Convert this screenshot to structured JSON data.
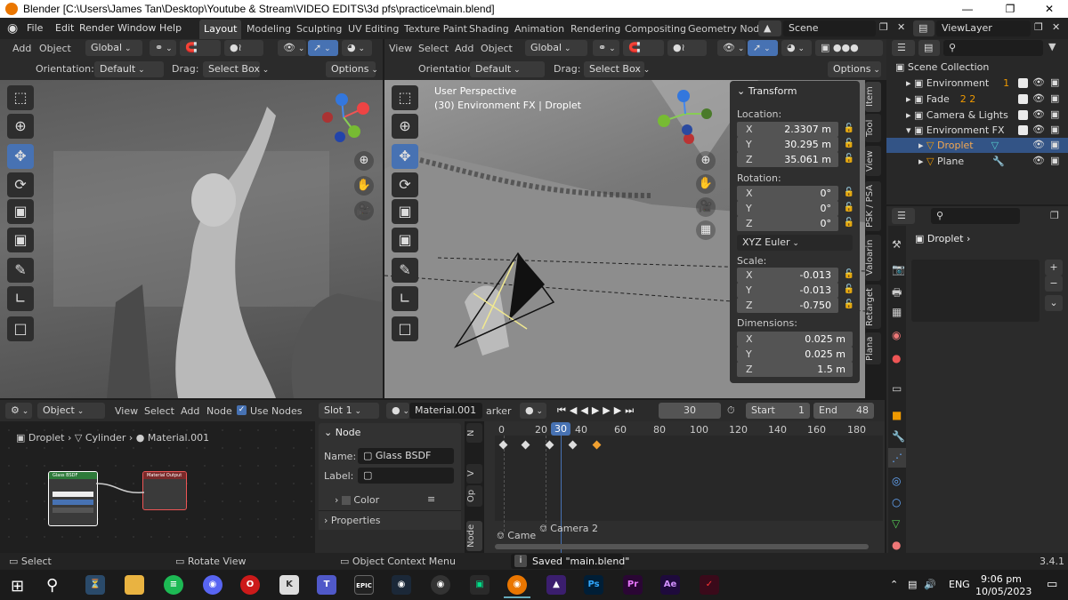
{
  "window": {
    "title": "Blender [C:\\Users\\James Tan\\Desktop\\Youtube & Stream\\VIDEO EDITS\\3d pfs\\practice\\main.blend]"
  },
  "menu": [
    "File",
    "Edit",
    "Render",
    "Window",
    "Help"
  ],
  "workspaces": [
    "Layout",
    "Modeling",
    "Sculpting",
    "UV Editing",
    "Texture Paint",
    "Shading",
    "Animation",
    "Rendering",
    "Compositing",
    "Geometry Node"
  ],
  "scene": "Scene",
  "view_layer": "ViewLayer",
  "left_vp": {
    "menu": [
      "Add",
      "Object"
    ],
    "transform": "Global",
    "orientation_label": "Orientation:",
    "orientation": "Default",
    "drag_label": "Drag:",
    "drag": "Select Box",
    "options": "Options"
  },
  "right_vp": {
    "menu": [
      "View",
      "Select",
      "Add",
      "Object"
    ],
    "transform": "Global",
    "orientation_label": "Orientation:",
    "orientation": "Default",
    "drag_label": "Drag:",
    "drag": "Select Box",
    "options": "Options",
    "info_line1": "User Perspective",
    "info_line2": "(30) Environment FX | Droplet"
  },
  "npanel": {
    "title": "Transform",
    "location_label": "Location:",
    "location": [
      {
        "axis": "X",
        "value": "2.3307 m"
      },
      {
        "axis": "Y",
        "value": "30.295 m"
      },
      {
        "axis": "Z",
        "value": "35.061 m"
      }
    ],
    "rotation_label": "Rotation:",
    "rotation": [
      {
        "axis": "X",
        "value": "0°"
      },
      {
        "axis": "Y",
        "value": "0°"
      },
      {
        "axis": "Z",
        "value": "0°"
      }
    ],
    "rotation_mode": "XYZ Euler",
    "scale_label": "Scale:",
    "scale": [
      {
        "axis": "X",
        "value": "-0.013"
      },
      {
        "axis": "Y",
        "value": "-0.013"
      },
      {
        "axis": "Z",
        "value": "-0.750"
      }
    ],
    "dimensions_label": "Dimensions:",
    "dimensions": [
      {
        "axis": "X",
        "value": "0.025 m"
      },
      {
        "axis": "Y",
        "value": "0.025 m"
      },
      {
        "axis": "Z",
        "value": "1.5 m"
      }
    ],
    "tabs": [
      "Item",
      "Tool",
      "View",
      "PSK / PSA",
      "Valoarin",
      "Retarget",
      "Plana"
    ]
  },
  "outliner": {
    "root": "Scene Collection",
    "items": [
      {
        "name": "Environment",
        "badge": "1",
        "selected": false
      },
      {
        "name": "Fade",
        "badge": "2 2",
        "selected": false
      },
      {
        "name": "Camera & Lights",
        "badge": "",
        "selected": false
      },
      {
        "name": "Environment FX",
        "badge": "",
        "selected": false
      },
      {
        "name": "Droplet",
        "badge": "",
        "selected": true
      },
      {
        "name": "Plane",
        "badge": "",
        "selected": false
      }
    ]
  },
  "properties": {
    "object": "Droplet"
  },
  "node_editor": {
    "mode": "Object",
    "menu": [
      "View",
      "Select",
      "Add",
      "Node"
    ],
    "use_nodes": "Use Nodes",
    "slot": "Slot 1",
    "material": "Material.001",
    "breadcrumb": [
      "Droplet",
      "Cylinder",
      "Material.001"
    ],
    "node_panel_title": "Node",
    "name_label": "Name:",
    "name_value": "Glass BSDF",
    "label_label": "Label:",
    "color_label": "Color",
    "properties_label": "Properties",
    "side_tabs": [
      "N",
      "V",
      "Op",
      "Node"
    ],
    "glass_node": "Glass BSDF",
    "output_node": "Material Output"
  },
  "timeline": {
    "marker": "arker",
    "current_frame": "30",
    "start_label": "Start",
    "start": "1",
    "end_label": "End",
    "end": "48",
    "ticks": [
      "0",
      "20",
      "30",
      "40",
      "60",
      "80",
      "100",
      "120",
      "140",
      "160",
      "180"
    ],
    "markers": [
      "Came",
      "Camera 2"
    ]
  },
  "status": {
    "select": "Select",
    "rotate": "Rotate View",
    "context": "Object Context Menu",
    "saved": "Saved \"main.blend\"",
    "version": "3.4.1"
  },
  "taskbar": {
    "lang": "ENG",
    "time": "9:06 pm",
    "date": "10/05/2023"
  }
}
